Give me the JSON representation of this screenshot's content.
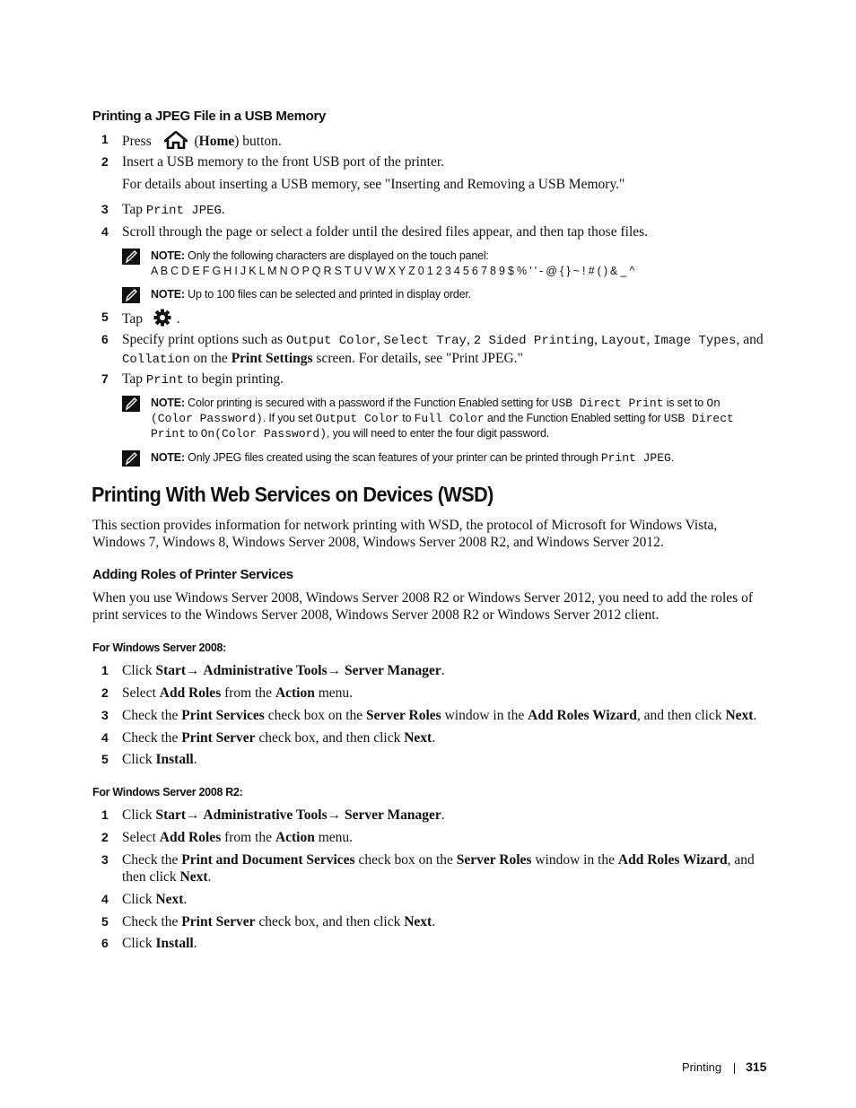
{
  "section1": {
    "heading": "Printing a JPEG File in a USB Memory",
    "steps": [
      {
        "num": "1",
        "pre": "Press",
        "icon": "home-icon",
        "mid": "(",
        "bold": "Home",
        "post": ") button."
      },
      {
        "num": "2",
        "text": "Insert a USB memory to the front USB port of the printer."
      },
      {
        "num": "3",
        "pre": "Tap",
        "code": "Print JPEG",
        "post": "."
      },
      {
        "num": "4",
        "text": "Scroll through the page or select a folder until the desired files appear, and then tap those files."
      },
      {
        "num": "5",
        "pre": "Tap",
        "icon": "gear-icon",
        "post": "."
      },
      {
        "num": "6",
        "pre": "Specify print options such as",
        "codes": [
          "Output Color",
          "Select Tray",
          "2 Sided Printing",
          "Layout",
          "Image Types",
          "Collation"
        ],
        "and": "and",
        "on_the": "on the",
        "bold": "Print Settings",
        "post": "screen. For details, see \"Print JPEG.\""
      },
      {
        "num": "7",
        "pre": "Tap",
        "code": "Print",
        "post": "to begin printing."
      }
    ],
    "step2_detail": "For details about inserting a USB memory, see \"Inserting and Removing a USB Memory.\"",
    "notes": [
      {
        "label": "NOTE:",
        "text": "Only the following characters are displayed on the touch panel:",
        "chars": "A B C D E F G H I J K L M N O P Q R S T U V W X Y Z 0 1 2 3 4 5 6 7 8 9 $ % ' ' - @ { } ~ ! # ( ) & _ ^"
      },
      {
        "label": "NOTE:",
        "text": "Up to 100 files can be selected and printed in display order."
      },
      {
        "label": "NOTE:",
        "t1": "Color printing is secured with a password if the Function Enabled setting for",
        "c1": "USB Direct Print",
        "t2": "is set to",
        "c2": "On (Color Password)",
        "t3": ". If you set",
        "c3": "Output Color",
        "t4": "to",
        "c4": "Full Color",
        "t5": "and the Function Enabled setting for",
        "c5": "USB Direct Print",
        "t6": "to",
        "c6": "On(Color Password)",
        "t7": ", you will need to enter the four digit password."
      },
      {
        "label": "NOTE:",
        "text": "Only JPEG files created using the scan features of your printer can be printed through",
        "code": "Print JPEG",
        "post": "."
      }
    ]
  },
  "section2": {
    "heading": "Printing With Web Services on Devices (WSD)",
    "intro": "This section provides information for network printing with WSD, the protocol of Microsoft for Windows Vista, Windows 7, Windows 8, Windows Server 2008, Windows Server 2008 R2, and Windows Server 2012.",
    "subheading": "Adding Roles of Printer Services",
    "sub_intro": "When you use Windows Server 2008, Windows Server 2008 R2 or Windows Server 2012, you need to add the roles of print services to the Windows Server 2008, Windows Server 2008 R2 or Windows Server 2012 client.",
    "ws2008": {
      "heading": "For Windows Server 2008:",
      "steps": [
        {
          "num": "1",
          "a": "Click",
          "b1": "Start",
          "arrow": "→",
          "b2": "Administrative Tools",
          "b3": "Server Manager",
          "end": "."
        },
        {
          "num": "2",
          "a": "Select",
          "b1": "Add Roles",
          "m1": "from the",
          "b2": "Action",
          "end": "menu."
        },
        {
          "num": "3",
          "a": "Check the",
          "b1": "Print Services",
          "m1": "check box on the",
          "b2": "Server Roles",
          "m2": "window in the",
          "b3": "Add Roles Wizard",
          "m3": ", and then click",
          "b4": "Next",
          "end": "."
        },
        {
          "num": "4",
          "a": "Check the",
          "b1": "Print Server",
          "m1": "check box, and then click",
          "b2": "Next",
          "end": "."
        },
        {
          "num": "5",
          "a": "Click",
          "b1": "Install",
          "end": "."
        }
      ]
    },
    "ws2008r2": {
      "heading": "For Windows Server 2008 R2:",
      "steps": [
        {
          "num": "1",
          "a": "Click",
          "b1": "Start",
          "arrow": "→",
          "b2": "Administrative Tools",
          "b3": "Server Manager",
          "end": "."
        },
        {
          "num": "2",
          "a": "Select",
          "b1": "Add Roles",
          "m1": "from the",
          "b2": "Action",
          "end": "menu."
        },
        {
          "num": "3",
          "a": "Check the",
          "b1": "Print and Document Services",
          "m1": "check box on the",
          "b2": "Server Roles",
          "m2": "window in the",
          "b3": "Add Roles Wizard",
          "m3": ", and then click",
          "b4": "Next",
          "end": "."
        },
        {
          "num": "4",
          "a": "Click",
          "b1": "Next",
          "end": "."
        },
        {
          "num": "5",
          "a": "Check the",
          "b1": "Print Server",
          "m1": "check box, and then click",
          "b2": "Next",
          "end": "."
        },
        {
          "num": "6",
          "a": "Click",
          "b1": "Install",
          "end": "."
        }
      ]
    }
  },
  "footer": {
    "section": "Printing",
    "page": "315"
  }
}
